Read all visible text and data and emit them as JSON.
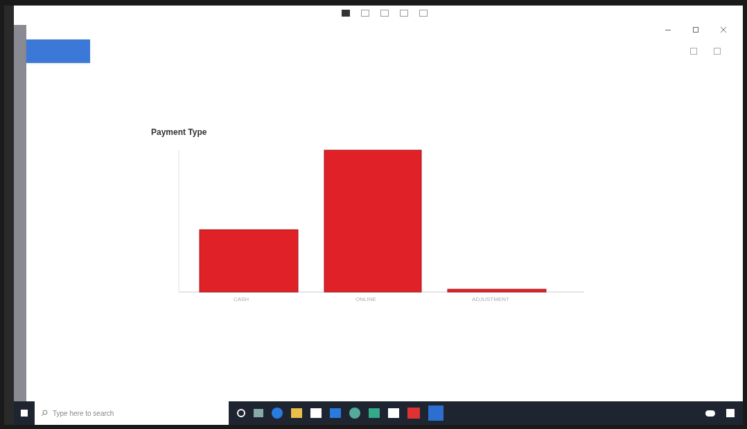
{
  "chart": {
    "title": "Payment Type",
    "categories": [
      "CASH",
      "ONLINE",
      "ADJUSTMENT"
    ]
  },
  "taskbar": {
    "search": {
      "placeholder": "Type here to search"
    }
  }
}
